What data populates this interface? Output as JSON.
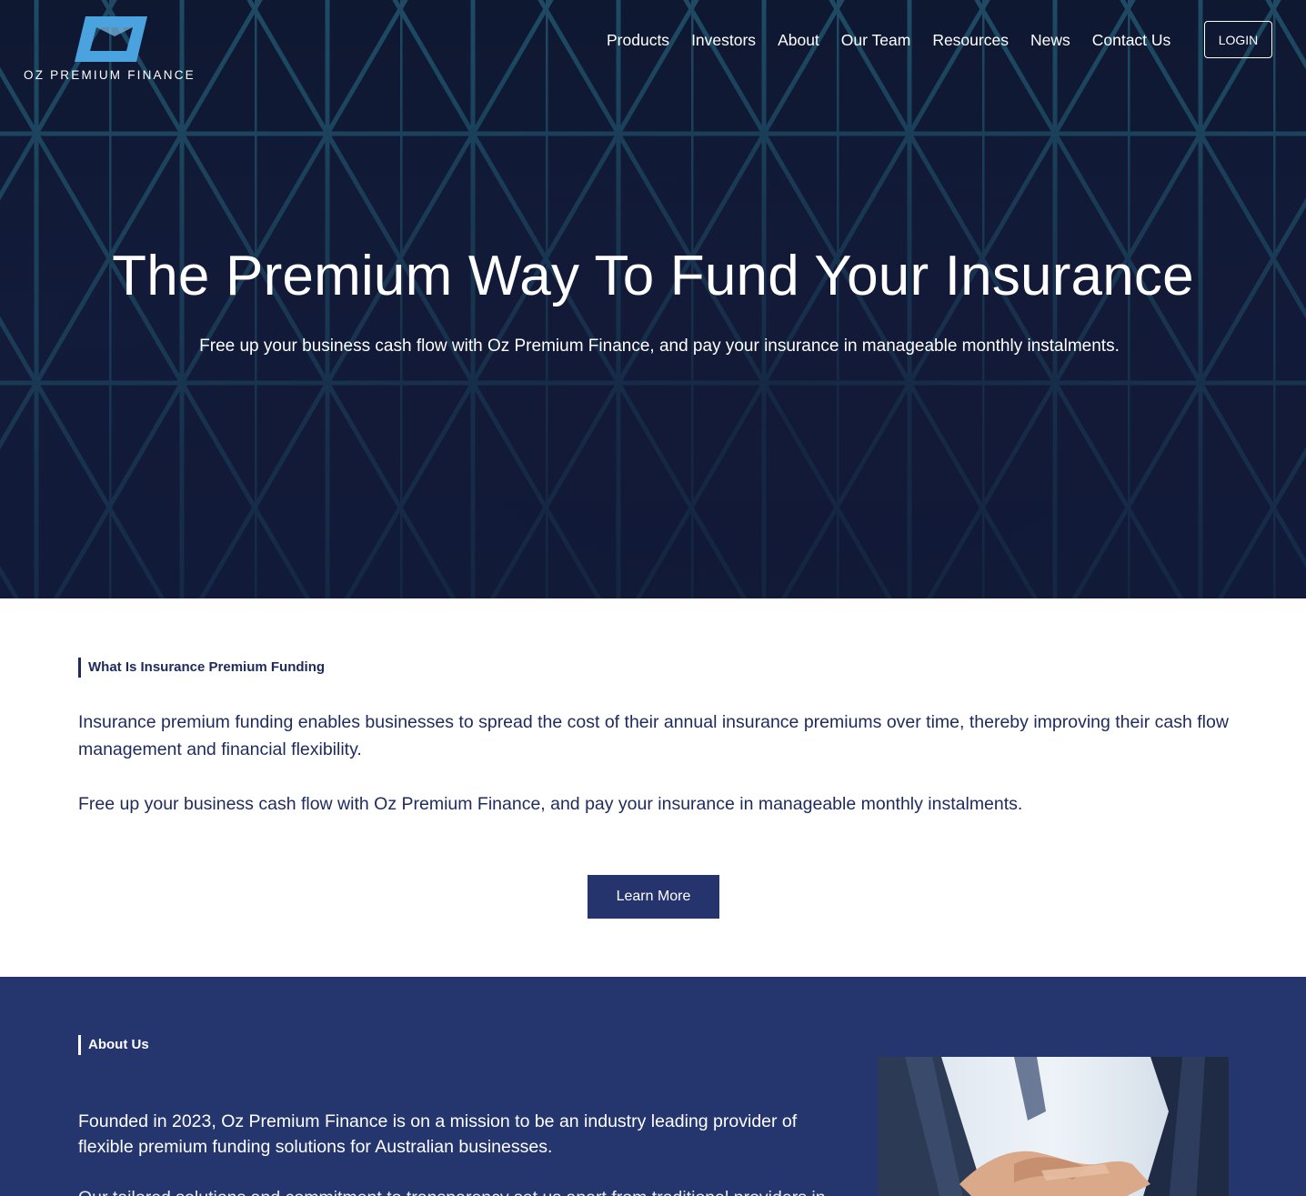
{
  "brand": {
    "logo_text": "OZ PREMIUM FINANCE",
    "accent_color": "#4aa3df"
  },
  "nav": {
    "items": [
      {
        "label": "Products"
      },
      {
        "label": "Investors"
      },
      {
        "label": "About"
      },
      {
        "label": "Our Team"
      },
      {
        "label": "Resources"
      },
      {
        "label": "News"
      },
      {
        "label": "Contact Us"
      }
    ],
    "login_label": "LOGIN"
  },
  "hero": {
    "title": "The Premium Way To Fund Your Insurance",
    "subtitle": "Free up your business cash flow with Oz Premium Finance, and pay your insurance in manageable monthly instalments.",
    "background_color": "#111a38"
  },
  "what_is": {
    "eyebrow": "What Is Insurance Premium Funding",
    "paragraph1": "Insurance premium funding enables businesses to spread the cost of their annual insurance premiums over time, thereby improving their cash flow management and financial flexibility.",
    "paragraph2": "Free up your business cash flow with Oz Premium Finance, and pay your insurance in manageable monthly instalments.",
    "button_label": "Learn More",
    "text_color": "#1f2a5c"
  },
  "about": {
    "eyebrow": "About Us",
    "paragraph1": "Founded in 2023, Oz Premium Finance is on a mission to be an industry leading provider of flexible premium funding solutions for Australian businesses.",
    "paragraph2": "Our tailored solutions and commitment to transparency set us apart from traditional providers in the market.",
    "background_color": "#25366f",
    "photo_icon": "handshake-photo"
  }
}
